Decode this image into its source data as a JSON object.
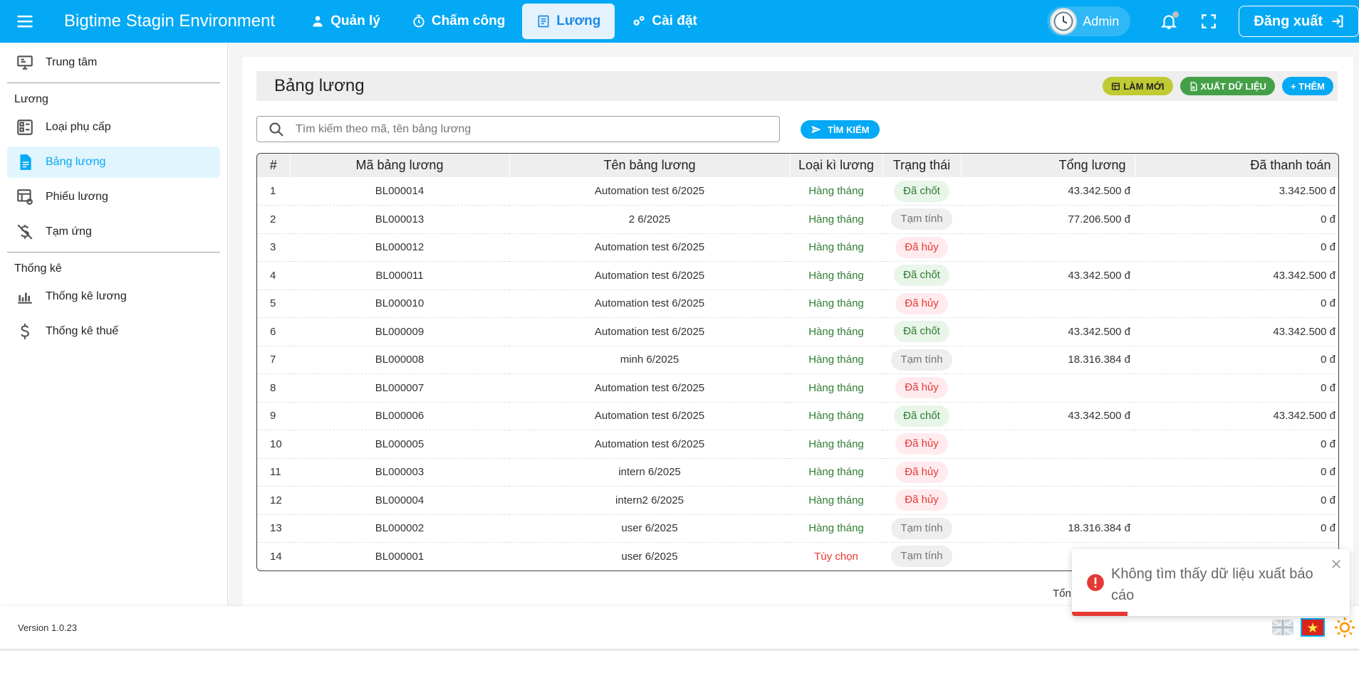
{
  "header": {
    "app_title": "Bigtime Stagin Environment",
    "nav": [
      {
        "label": "Quản lý",
        "icon": "user-manage-icon"
      },
      {
        "label": "Chấm công",
        "icon": "stopwatch-icon"
      },
      {
        "label": "Lương",
        "icon": "payroll-icon",
        "active": true
      },
      {
        "label": "Cài đặt",
        "icon": "gears-icon"
      }
    ],
    "user_name": "Admin",
    "logout_label": "Đăng xuất"
  },
  "sidebar": {
    "top_item": "Trung tâm",
    "section_luong": "Lương",
    "items_luong": [
      "Loại phụ cấp",
      "Bảng lương",
      "Phiếu lương",
      "Tạm ứng"
    ],
    "active_item": "Bảng lương",
    "section_thongke": "Thống kê",
    "items_thongke": [
      "Thống kê lương",
      "Thống kê thuế"
    ]
  },
  "page": {
    "title": "Bảng lương",
    "actions": {
      "refresh": "LÀM MỚI",
      "export": "XUẤT DỮ LIỆU",
      "add": "+ THÊM"
    },
    "search": {
      "placeholder": "Tìm kiếm theo mã, tên bảng lương",
      "value": "",
      "button": "TÌM KIẾM"
    },
    "table": {
      "columns": [
        "#",
        "Mã bảng lương",
        "Tên bảng lương",
        "Loại kì lương",
        "Trạng thái",
        "Tổng lương",
        "Đã thanh toán"
      ],
      "rows": [
        {
          "no": "1",
          "code": "BL000014",
          "name": "Automation test 6/2025",
          "type": "Hàng tháng",
          "status": "Đã chốt",
          "total": "43.342.500 đ",
          "paid": "3.342.500 đ"
        },
        {
          "no": "2",
          "code": "BL000013",
          "name": "2 6/2025",
          "type": "Hàng tháng",
          "status": "Tạm tính",
          "total": "77.206.500 đ",
          "paid": "0 đ"
        },
        {
          "no": "3",
          "code": "BL000012",
          "name": "Automation test 6/2025",
          "type": "Hàng tháng",
          "status": "Đã hủy",
          "total": "",
          "paid": "0 đ"
        },
        {
          "no": "4",
          "code": "BL000011",
          "name": "Automation test 6/2025",
          "type": "Hàng tháng",
          "status": "Đã chốt",
          "total": "43.342.500 đ",
          "paid": "43.342.500 đ"
        },
        {
          "no": "5",
          "code": "BL000010",
          "name": "Automation test 6/2025",
          "type": "Hàng tháng",
          "status": "Đã hủy",
          "total": "",
          "paid": "0 đ"
        },
        {
          "no": "6",
          "code": "BL000009",
          "name": "Automation test 6/2025",
          "type": "Hàng tháng",
          "status": "Đã chốt",
          "total": "43.342.500 đ",
          "paid": "43.342.500 đ"
        },
        {
          "no": "7",
          "code": "BL000008",
          "name": "minh 6/2025",
          "type": "Hàng tháng",
          "status": "Tạm tính",
          "total": "18.316.384 đ",
          "paid": "0 đ"
        },
        {
          "no": "8",
          "code": "BL000007",
          "name": "Automation test 6/2025",
          "type": "Hàng tháng",
          "status": "Đã hủy",
          "total": "",
          "paid": "0 đ"
        },
        {
          "no": "9",
          "code": "BL000006",
          "name": "Automation test 6/2025",
          "type": "Hàng tháng",
          "status": "Đã chốt",
          "total": "43.342.500 đ",
          "paid": "43.342.500 đ"
        },
        {
          "no": "10",
          "code": "BL000005",
          "name": "Automation test 6/2025",
          "type": "Hàng tháng",
          "status": "Đã hủy",
          "total": "",
          "paid": "0 đ"
        },
        {
          "no": "11",
          "code": "BL000003",
          "name": "intern 6/2025",
          "type": "Hàng tháng",
          "status": "Đã hủy",
          "total": "",
          "paid": "0 đ"
        },
        {
          "no": "12",
          "code": "BL000004",
          "name": "intern2 6/2025",
          "type": "Hàng tháng",
          "status": "Đã hủy",
          "total": "",
          "paid": "0 đ"
        },
        {
          "no": "13",
          "code": "BL000002",
          "name": "user 6/2025",
          "type": "Hàng tháng",
          "status": "Tạm tính",
          "total": "18.316.384 đ",
          "paid": "0 đ"
        },
        {
          "no": "14",
          "code": "BL000001",
          "name": "user 6/2025",
          "type": "Tùy chọn",
          "status": "Tạm tính",
          "total": "19",
          "paid": "0 đ"
        }
      ]
    },
    "total_label_partial": "Tổn"
  },
  "footer": {
    "version": "Version 1.0.23"
  },
  "toast": {
    "message": "Không tìm thấy dữ liệu xuất báo cáo",
    "progress": 0.2
  },
  "colors": {
    "primary": "#03a9f4",
    "refresh": "#c0ca33",
    "export": "#43a047",
    "done": "#2e7d32",
    "cancel": "#e53935",
    "temp": "#757575"
  }
}
